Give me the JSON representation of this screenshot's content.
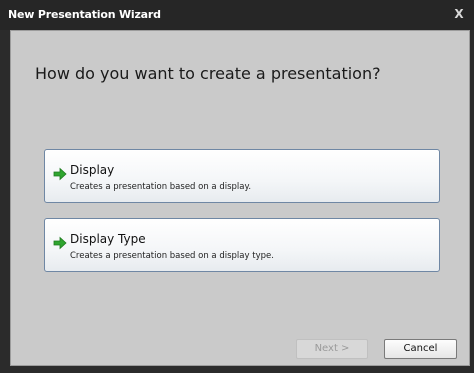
{
  "window": {
    "title": "New Presentation Wizard",
    "close_label": "X"
  },
  "main": {
    "heading": "How do you want to create a presentation?",
    "options": [
      {
        "icon": "green-arrow-icon",
        "title": "Display",
        "description": "Creates a presentation based on a display."
      },
      {
        "icon": "green-arrow-icon",
        "title": "Display Type",
        "description": "Creates a presentation based on a display type."
      }
    ]
  },
  "footer": {
    "next_label": "Next >",
    "cancel_label": "Cancel"
  },
  "colors": {
    "titlebar": "#262626",
    "panel": "#cacaca",
    "option_border": "#6f87a4",
    "arrow_green": "#2fa52f"
  }
}
